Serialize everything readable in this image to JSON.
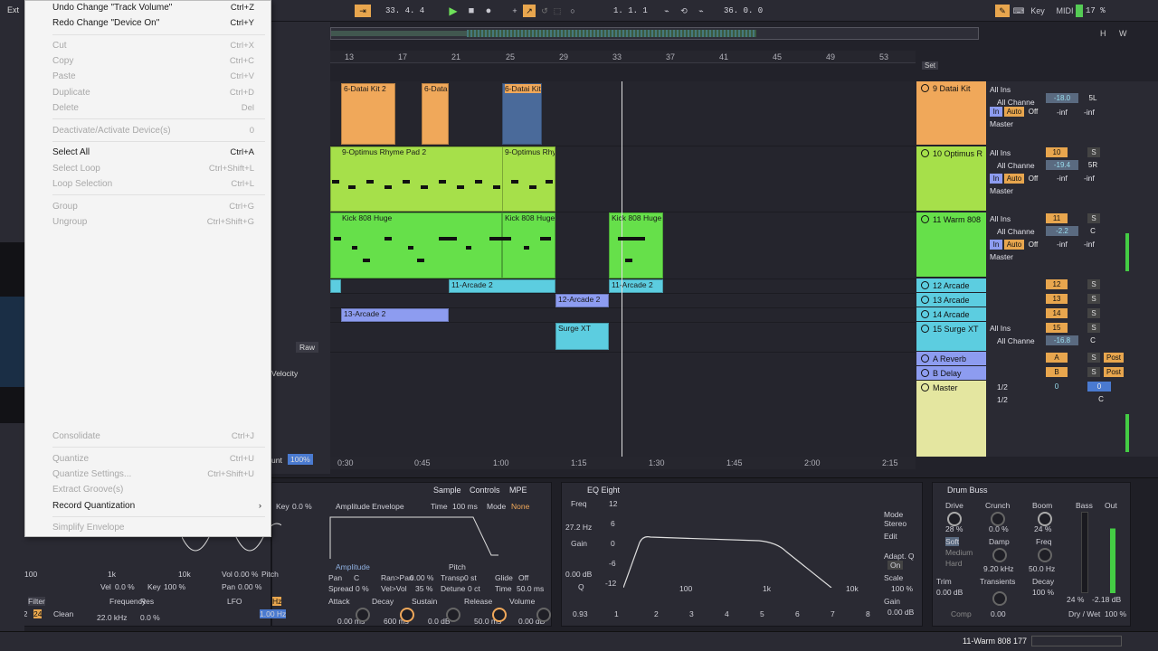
{
  "transport": {
    "ext": "Ext",
    "position": "33.  4.  4",
    "loop_start": "1.  1.  1",
    "loop_length": "36.  0.  0",
    "key_label": "Key",
    "midi_label": "MIDI",
    "cpu": "17 %"
  },
  "ruler": {
    "bars": [
      "13",
      "17",
      "21",
      "25",
      "29",
      "33",
      "37",
      "41",
      "45",
      "49",
      "53"
    ],
    "set_label": "Set"
  },
  "timebar": {
    "labels": [
      "0:30",
      "0:45",
      "1:00",
      "1:15",
      "1:30",
      "1:45",
      "2:00",
      "2:15"
    ]
  },
  "clips": {
    "datai_kit_1": "6-Datai Kit 2",
    "datai_kit_2": "6-Datai",
    "datai_kit_3": "6-Datai Kit",
    "optimus_1": "9-Optimus Rhyme Pad 2",
    "optimus_2": "9-Optimus Rhy",
    "kick_1": "Kick 808 Huge",
    "kick_2": "Kick 808 Huge",
    "kick_3": "Kick 808 Huge",
    "arcade_1": "11-Arcade 2",
    "arcade_2": "12-Arcade 2",
    "arcade_3": "11-Arcade 2",
    "arcade_4": "13-Arcade 2",
    "surge": "Surge XT"
  },
  "tracks": [
    {
      "name": "9 Datai Kit",
      "color": "#f0a85a"
    },
    {
      "name": "10 Optimus R",
      "color": "#a6e04a"
    },
    {
      "name": "11 Warm 808",
      "color": "#66e04a"
    },
    {
      "name": "12 Arcade",
      "color": "#5ccde0"
    },
    {
      "name": "13 Arcade",
      "color": "#5ccde0"
    },
    {
      "name": "14 Arcade",
      "color": "#5ccde0"
    },
    {
      "name": "15 Surge XT",
      "color": "#5ccde0"
    },
    {
      "name": "A Reverb",
      "color": "#8d9cf0"
    },
    {
      "name": "B Delay",
      "color": "#8d9cf0"
    },
    {
      "name": "Master",
      "color": "#e4e6a0"
    }
  ],
  "mixer": {
    "all_ins": "All Ins",
    "all_channels": "All Channe",
    "master": "Master",
    "in": "In",
    "auto": "Auto",
    "off": "Off",
    "neg_inf": "-inf",
    "post": "Post",
    "half": "1/2",
    "s": "S",
    "center": "C",
    "track9": {
      "num": "9",
      "vol": "-18.0",
      "pan": "5L"
    },
    "track10": {
      "num": "10",
      "vol": "-19.4",
      "pan": "5R"
    },
    "track11": {
      "num": "11",
      "vol": "-2.2",
      "pan": "C"
    },
    "track12": {
      "num": "12"
    },
    "track13": {
      "num": "13"
    },
    "track14": {
      "num": "14"
    },
    "track15": {
      "num": "15",
      "vol": "-16.8",
      "pan": "C"
    },
    "ret_a": "A",
    "ret_b": "B",
    "master_val": "0"
  },
  "menu": {
    "items": [
      {
        "label": "Undo Change \"Track Volume\"",
        "shortcut": "Ctrl+Z",
        "enabled": true
      },
      {
        "label": "Redo Change \"Device On\"",
        "shortcut": "Ctrl+Y",
        "enabled": true
      },
      {
        "label": "Cut",
        "shortcut": "Ctrl+X",
        "enabled": false
      },
      {
        "label": "Copy",
        "shortcut": "Ctrl+C",
        "enabled": false
      },
      {
        "label": "Paste",
        "shortcut": "Ctrl+V",
        "enabled": false
      },
      {
        "label": "Duplicate",
        "shortcut": "Ctrl+D",
        "enabled": false
      },
      {
        "label": "Delete",
        "shortcut": "Del",
        "enabled": false
      },
      {
        "label": "Deactivate/Activate Device(s)",
        "shortcut": "0",
        "enabled": false
      },
      {
        "label": "Select All",
        "shortcut": "Ctrl+A",
        "enabled": true
      },
      {
        "label": "Select Loop",
        "shortcut": "Ctrl+Shift+L",
        "enabled": false
      },
      {
        "label": "Loop Selection",
        "shortcut": "Ctrl+L",
        "enabled": false
      },
      {
        "label": "Group",
        "shortcut": "Ctrl+G",
        "enabled": false
      },
      {
        "label": "Ungroup",
        "shortcut": "Ctrl+Shift+G",
        "enabled": false
      },
      {
        "label": "Consolidate",
        "shortcut": "Ctrl+J",
        "enabled": false
      },
      {
        "label": "Quantize",
        "shortcut": "Ctrl+U",
        "enabled": false
      },
      {
        "label": "Quantize Settings...",
        "shortcut": "Ctrl+Shift+U",
        "enabled": false
      },
      {
        "label": "Extract Groove(s)",
        "shortcut": "",
        "enabled": false
      },
      {
        "label": "Record Quantization",
        "shortcut": "",
        "enabled": true
      },
      {
        "label": "Simplify Envelope",
        "shortcut": "",
        "enabled": false
      }
    ]
  },
  "sampler": {
    "tabs": [
      "Sample",
      "Controls",
      "MPE"
    ],
    "amp_env": "Amplitude Envelope",
    "time": "Time",
    "time_val": "100 ms",
    "mode": "Mode",
    "mode_val": "None",
    "key_label": "Key",
    "key_val": "0.0 %",
    "vel_label": "Vel",
    "vel_val": "0.0 %",
    "key2": "Key",
    "key2_val": "100 %",
    "vol_label": "Vol",
    "vol_val": "0.00 %",
    "pitch_label": "Pitch",
    "pitch_val": "0.00 %",
    "pan_label": "Pan",
    "pan_val": "0.00 %",
    "filter_label": "Filter",
    "freq_label": "Frequency",
    "freq_val": "22.0 kHz",
    "res_label": "Res",
    "res_val": "0.0 %",
    "clean": "Clean",
    "num12": "12",
    "num24": "24",
    "lfo": "LFO",
    "hz": "Hz",
    "lfo_val": "1.00 Hz",
    "amplitude": "Amplitude",
    "pitch": "Pitch",
    "pan": "Pan",
    "pan_c": "C",
    "ran_pan": "Ran>Pan",
    "ran_pan_val": "0.00 %",
    "transp": "Transp",
    "transp_val": "0 st",
    "glide": "Glide",
    "glide_val": "Off",
    "spread": "Spread",
    "spread_val": "0 %",
    "vel_vol": "Vel>Vol",
    "vel_vol_val": "35 %",
    "detune": "Detune",
    "detune_val": "0 ct",
    "time2": "Time",
    "time2_val": "50.0 ms",
    "attack": "Attack",
    "attack_val": "0.00 ms",
    "decay": "Decay",
    "decay_val": "600 ms",
    "sustain": "Sustain",
    "sustain_val": "0.0 dB",
    "release": "Release",
    "release_val": "50.0 ms",
    "volume": "Volume",
    "volume_val": "0.00 dB",
    "axis_100": "100",
    "axis_1k": "1k",
    "axis_10k": "10k",
    "velocity_tab": "Velocity",
    "raw_tab": "Raw",
    "amount": "unt",
    "amount_val": "100%"
  },
  "eq": {
    "title": "EQ Eight",
    "freq": "Freq",
    "freq_val": "27.2 Hz",
    "gain": "Gain",
    "gain_val": "0.00 dB",
    "q": "Q",
    "q_val": "0.93",
    "mode": "Mode",
    "mode_val": "Stereo",
    "edit": "Edit",
    "adapt_q": "Adapt. Q",
    "on": "On",
    "scale": "Scale",
    "scale_val": "100 %",
    "gain2": "Gain",
    "gain2_val": "0.00 dB",
    "db_labels": [
      "12",
      "6",
      "0",
      "-6",
      "-12"
    ],
    "freq_labels": [
      "100",
      "1k",
      "10k"
    ],
    "bands": [
      "1",
      "2",
      "3",
      "4",
      "5",
      "6",
      "7",
      "8"
    ]
  },
  "drumbuss": {
    "title": "Drum Buss",
    "drive": "Drive",
    "drive_val": "28 %",
    "soft": "Soft",
    "medium": "Medium",
    "hard": "Hard",
    "trim": "Trim",
    "trim_val": "0.00 dB",
    "comp": "Comp",
    "crunch": "Crunch",
    "crunch_val": "0.0 %",
    "damp": "Damp",
    "damp_val": "9.20 kHz",
    "transients": "Transients",
    "transients_val": "0.00",
    "boom": "Boom",
    "boom_val": "24 %",
    "freq": "Freq",
    "freq_val": "50.0 Hz",
    "decay": "Decay",
    "decay_val": "100 %",
    "bass": "Bass",
    "out": "Out",
    "out_val1": "24 %",
    "out_val2": "-2.18 dB",
    "drywet": "Dry / Wet",
    "drywet_val": "100 %"
  },
  "status": {
    "track_name": "11-Warm 808 177"
  },
  "colors": {
    "orange": "#f0a85a",
    "lime": "#a6e04a",
    "green": "#66e04a",
    "cyan": "#5ccde0",
    "lavender": "#8d9cf0",
    "accent": "#f0a85a"
  }
}
